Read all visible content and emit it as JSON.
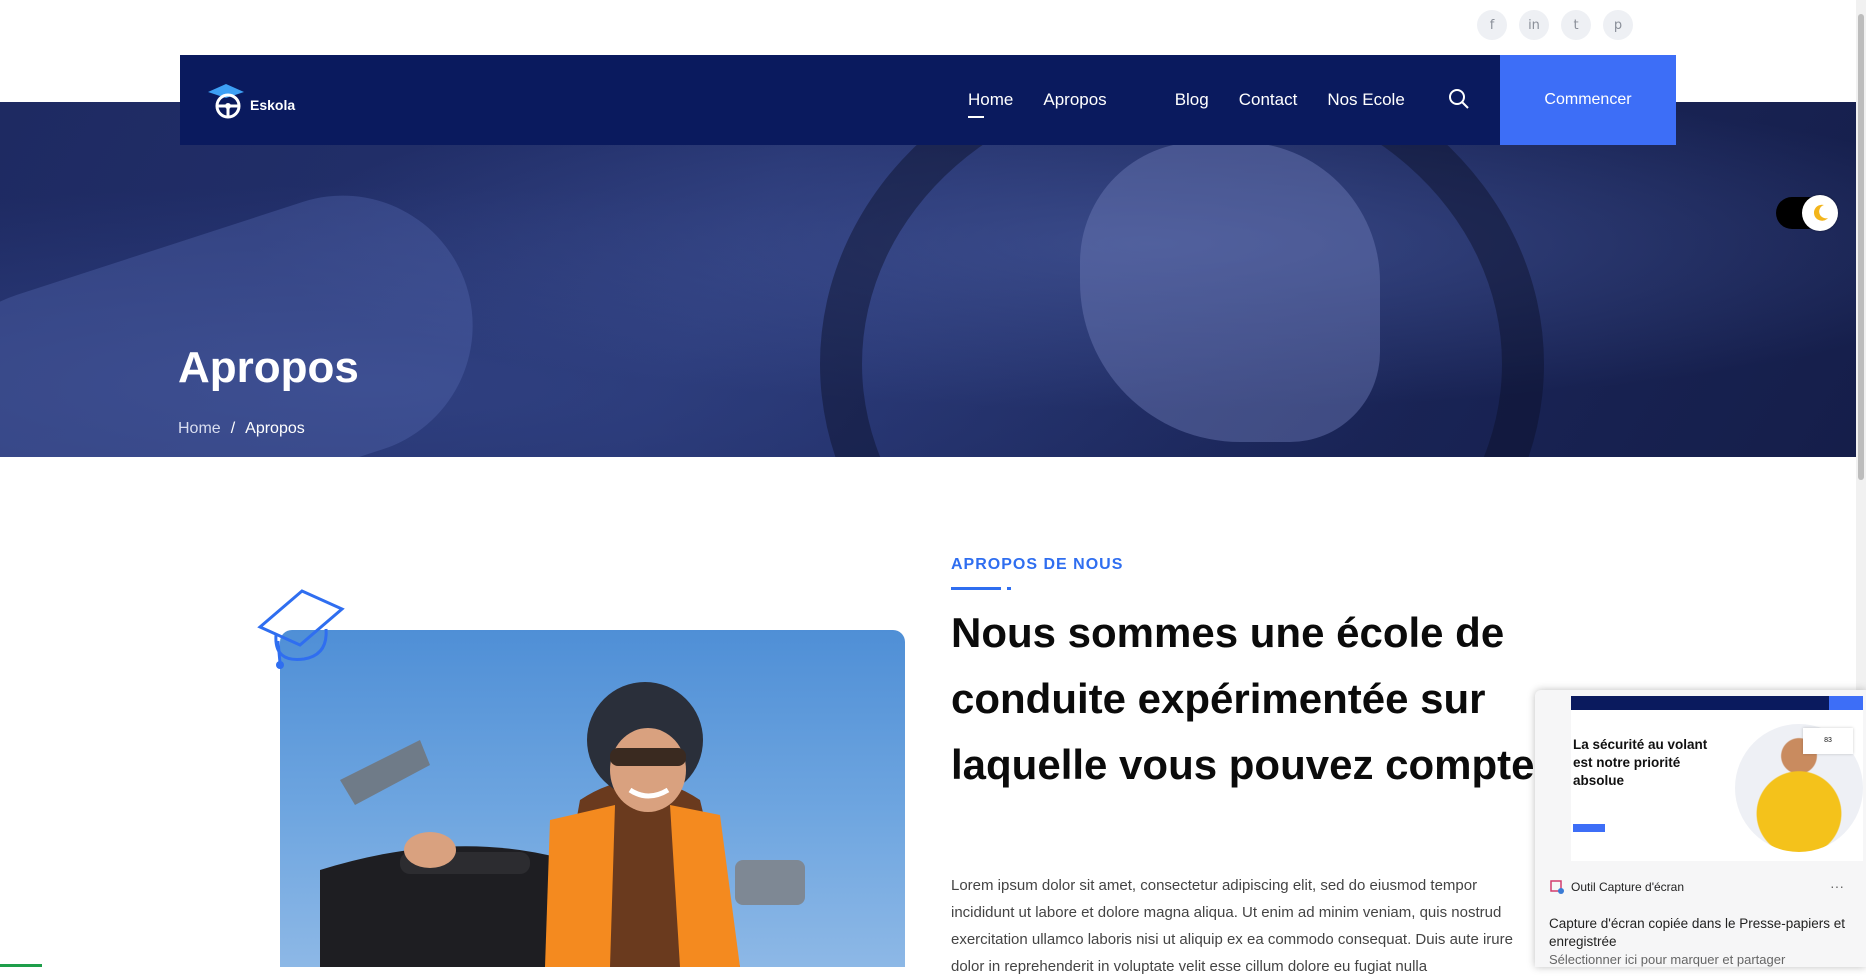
{
  "social": {
    "facebook": "f",
    "linkedin": "in",
    "twitter": "t",
    "pinterest": "p"
  },
  "nav": {
    "brand": "Eskola",
    "items": [
      "Home",
      "Apropos",
      "Blog",
      "Contact",
      "Nos Ecole"
    ],
    "active_item": "Home",
    "cta_label": "Commencer"
  },
  "hero": {
    "title": "Apropos",
    "breadcrumb": {
      "home": "Home",
      "separator": "/",
      "current": "Apropos"
    }
  },
  "about": {
    "eyebrow": "APROPOS DE NOUS",
    "heading": "Nous sommes une école de conduite expérimentée sur laquelle vous pouvez compter",
    "text": "Lorem ipsum dolor sit amet, consectetur adipiscing elit, sed do eiusmod tempor incididunt ut labore et dolore magna aliqua. Ut enim ad minim veniam, quis nostrud exercitation ullamco laboris nisi ut aliquip ex ea commodo consequat. Duis aute irure dolor in reprehenderit in voluptate velit esse cillum dolore eu fugiat nulla"
  },
  "notification": {
    "preview_title": "La sécurité au volant est notre priorité absolue",
    "preview_badge": "83",
    "app_name": "Outil Capture d'écran",
    "more": "···",
    "message": "Capture d'écran copiée dans le Presse-papiers et enregistrée",
    "hint": "Sélectionner ici pour marquer et partager"
  },
  "colors": {
    "nav_bg": "#0a1a5e",
    "accent": "#3d6ef7",
    "eyebrow": "#2f6ef0"
  }
}
